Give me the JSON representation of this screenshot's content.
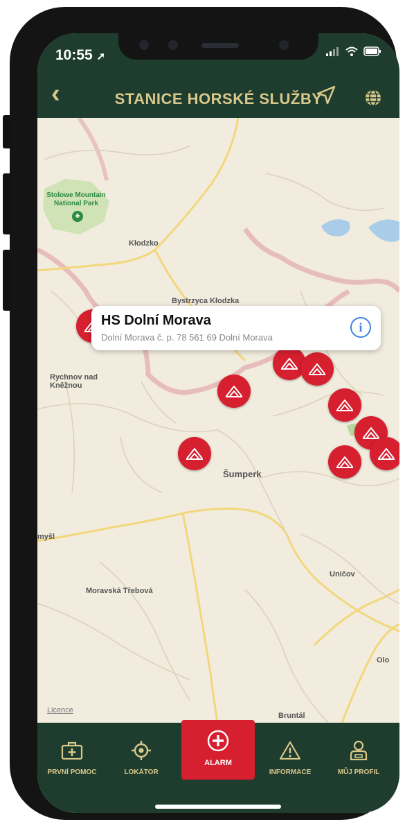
{
  "status": {
    "time": "10:55"
  },
  "nav": {
    "title": "STANICE HORSKÉ SLUŽBY"
  },
  "map": {
    "park_label": "Stolowe Mountain National Park",
    "towns": [
      "Kłodzko",
      "Bystrzyca Kłodzka",
      "Rychnov nad Kněžnou",
      "Šumperk",
      "Moravská Třebová",
      "Uničov",
      "myšl",
      "Olo",
      "Bruntál"
    ],
    "legal": "Licence"
  },
  "callout": {
    "title": "HS Dolní Morava",
    "address": "Dolní Morava č. p. 78  561 69 Dolní Morava"
  },
  "tabs": {
    "first_aid": "PRVNÍ POMOC",
    "locator": "LOKÁTOR",
    "alarm": "ALARM",
    "info": "INFORMACE",
    "profile": "MŮJ PROFIL"
  },
  "colors": {
    "header_green": "#1e3d2f",
    "gold": "#d9c88a",
    "alarm_red": "#d61f2f",
    "map_bg": "#f1ecde"
  },
  "icons": [
    "location-arrow-icon",
    "globe-icon",
    "first-aid-kit-icon",
    "locator-crosshair-icon",
    "plus-circle-icon",
    "warning-triangle-icon",
    "profile-person-icon",
    "mountain-rescue-marker-icon"
  ]
}
